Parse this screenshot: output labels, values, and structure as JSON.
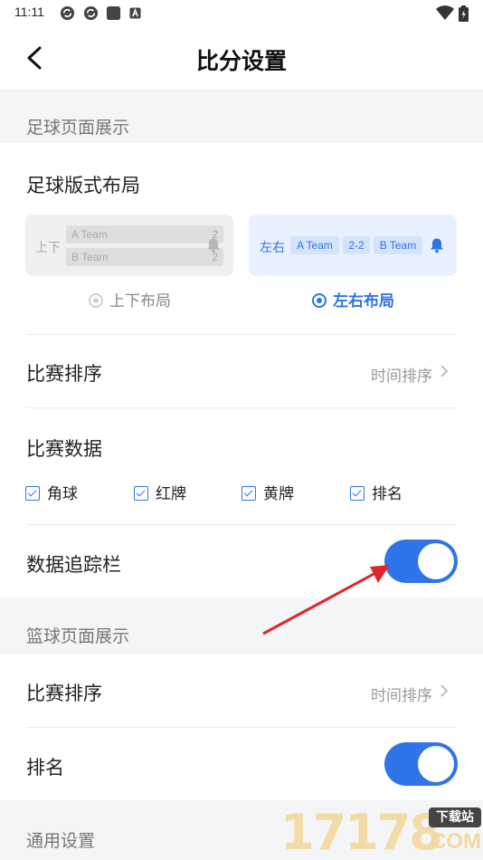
{
  "status_bar": {
    "time": "11:11",
    "notification_icons": [
      "sync-icon",
      "sync-icon",
      "square-icon",
      "a-badge-icon"
    ],
    "right_icons": [
      "wifi-icon",
      "battery-charging-icon"
    ]
  },
  "header": {
    "title": "比分设置",
    "back_icon": "chevron-left-icon"
  },
  "football": {
    "section_title": "足球页面展示",
    "layout": {
      "label": "足球版式布局",
      "option_a": {
        "card_label": "上下",
        "team_a": "A Team",
        "score_a": "2",
        "team_b": "B Team",
        "score_b": "2",
        "radio_label": "上下布局",
        "selected": false
      },
      "option_b": {
        "card_label": "左右",
        "team_a": "A Team",
        "score": "2-2",
        "team_b": "B Team",
        "radio_label": "左右布局",
        "selected": true
      }
    },
    "match_sort": {
      "label": "比赛排序",
      "value": "时间排序"
    },
    "match_data": {
      "label": "比赛数据",
      "checkboxes": [
        {
          "label": "角球",
          "checked": true
        },
        {
          "label": "红牌",
          "checked": true
        },
        {
          "label": "黄牌",
          "checked": true
        },
        {
          "label": "排名",
          "checked": true
        }
      ]
    },
    "tracker": {
      "label": "数据追踪栏",
      "enabled": true
    }
  },
  "basketball": {
    "section_title": "篮球页面展示",
    "match_sort": {
      "label": "比赛排序",
      "value": "时间排序"
    },
    "ranking": {
      "label": "排名",
      "enabled": true
    }
  },
  "general": {
    "section_title": "通用设置"
  },
  "watermark": {
    "number": "17178",
    "tag": "下载站",
    "domain": "COM"
  },
  "colors": {
    "accent": "#2f74e8",
    "section_bg": "#f4f5f7",
    "annotation_arrow": "#e0262a"
  }
}
